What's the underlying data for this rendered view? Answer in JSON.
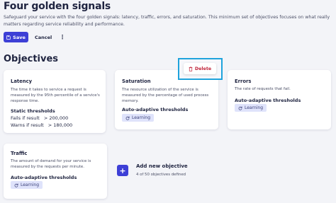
{
  "header": {
    "title": "Four golden signals",
    "description": "Safeguard your service with the four golden signals: latency, traffic, errors, and saturation. This minimum set of objectives focuses on what really matters regarding service reliability and performance."
  },
  "toolbar": {
    "save_label": "Save",
    "cancel_label": "Cancel",
    "more_label": "⋮"
  },
  "section_title": "Objectives",
  "cards": {
    "latency": {
      "title": "Latency",
      "description": "The time it takes to service a request is measured by the 95th percentile of a service's response time.",
      "thresholds_title": "Static thresholds",
      "fails_label": "Fails if result",
      "fails_value": "> 200,000",
      "warns_label": "Warns if result",
      "warns_value": "> 180,000"
    },
    "saturation": {
      "title": "Saturation",
      "description": "The resource utilization of the service is measured by the percentage of used process memory.",
      "thresholds_title": "Auto-adaptive thresholds",
      "chip_label": "Learning"
    },
    "errors": {
      "title": "Errors",
      "description": "The rate of requests that fail.",
      "thresholds_title": "Auto-adaptive thresholds",
      "chip_label": "Learning"
    },
    "traffic": {
      "title": "Traffic",
      "description": "The amount of demand for your service is measured by the requests per minute.",
      "thresholds_title": "Auto-adaptive thresholds",
      "chip_label": "Learning"
    }
  },
  "delete_popup": {
    "label": "Delete"
  },
  "add_objective": {
    "icon": "+",
    "title": "Add new objective",
    "subtitle": "4 of 50 objectives defined"
  },
  "colors": {
    "primary": "#3d3fd6",
    "danger": "#c0243b",
    "highlight_border": "#1fa3dc",
    "chip_bg": "#dfe3fb"
  }
}
